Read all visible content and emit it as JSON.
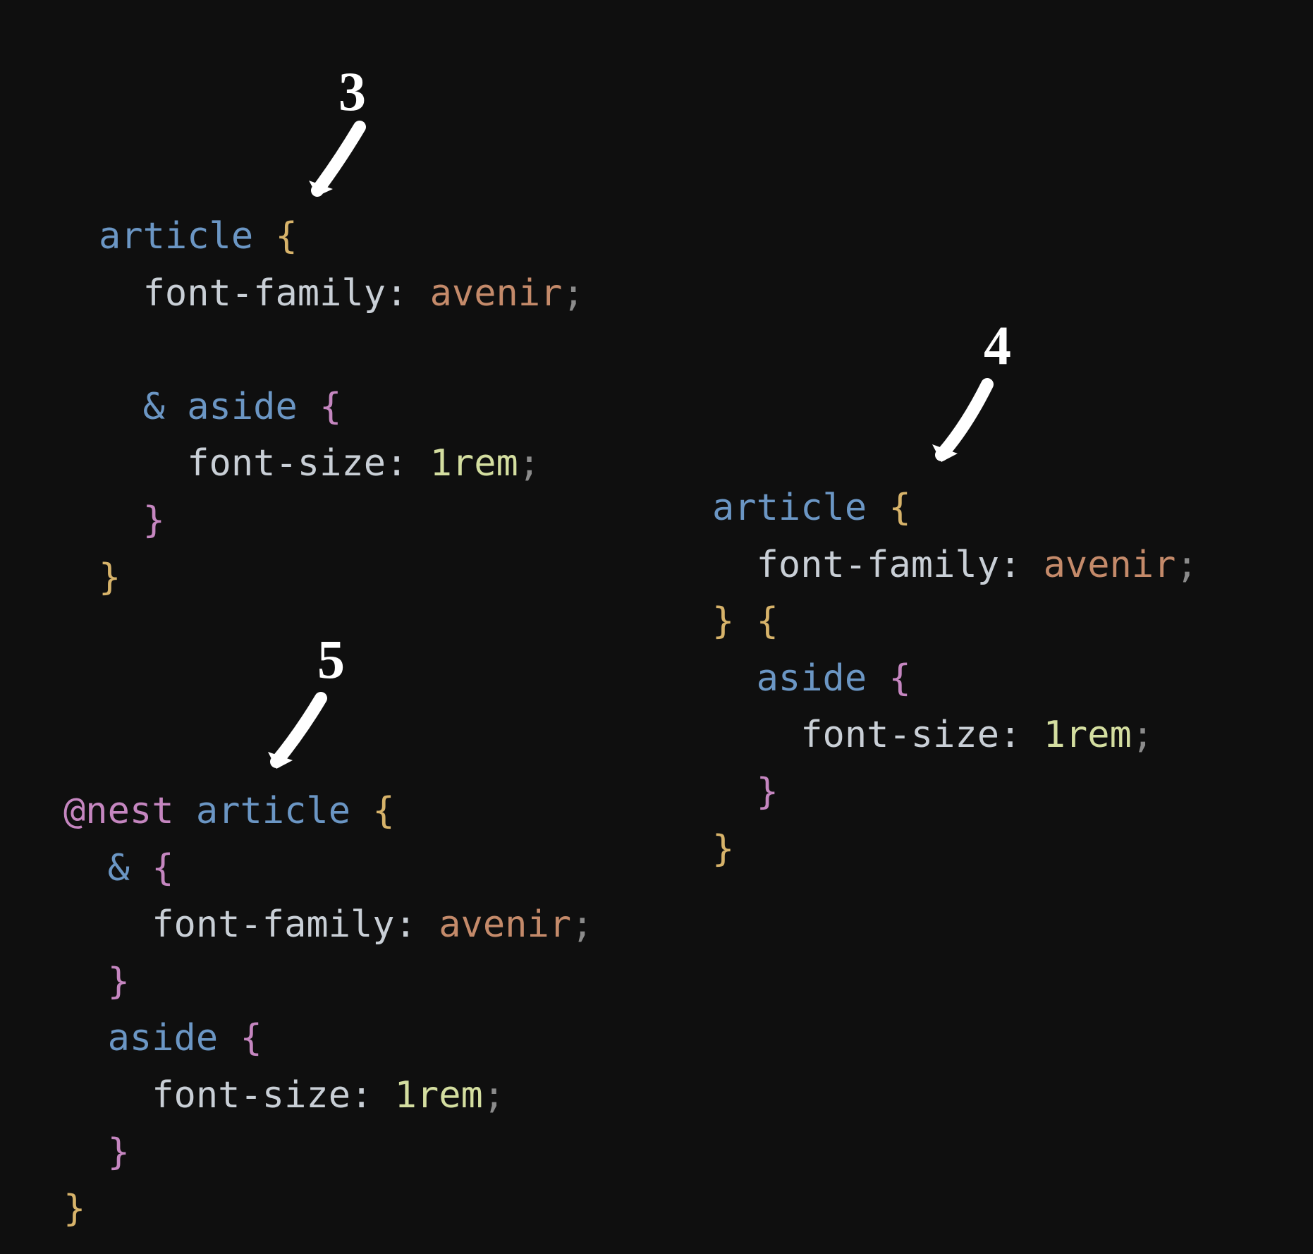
{
  "colors": {
    "background": "#0f0f0f",
    "selector": "#6b96c4",
    "brace_yellow": "#d7b36a",
    "brace_pink": "#c586c0",
    "property": "#c9cfd6",
    "value_ident": "#c48a6a",
    "value_num": "#d4dea0",
    "punct": "#8b8b8b",
    "at_rule": "#c586c0",
    "annotation": "#ffffff"
  },
  "annotations": {
    "block3": {
      "label": "3"
    },
    "block4": {
      "label": "4"
    },
    "block5": {
      "label": "5"
    }
  },
  "code_blocks": {
    "block3": {
      "tokens": {
        "sel_article": "article",
        "ob": "{",
        "prop_ff": "font-family",
        "colon": ":",
        "val_avenir": "avenir",
        "semi": ";",
        "amp": "&",
        "sel_aside": "aside",
        "prop_fs": "font-size",
        "val_1rem": "1rem",
        "cb": "}"
      }
    },
    "block4": {
      "tokens": {
        "sel_article": "article",
        "ob": "{",
        "prop_ff": "font-family",
        "colon": ":",
        "val_avenir": "avenir",
        "semi": ";",
        "cb": "}",
        "sel_aside": "aside",
        "prop_fs": "font-size",
        "val_1rem": "1rem"
      }
    },
    "block5": {
      "tokens": {
        "at_nest": "@nest",
        "sel_article": "article",
        "ob": "{",
        "amp": "&",
        "prop_ff": "font-family",
        "colon": ":",
        "val_avenir": "avenir",
        "semi": ";",
        "cb": "}",
        "sel_aside": "aside",
        "prop_fs": "font-size",
        "val_1rem": "1rem"
      }
    }
  }
}
